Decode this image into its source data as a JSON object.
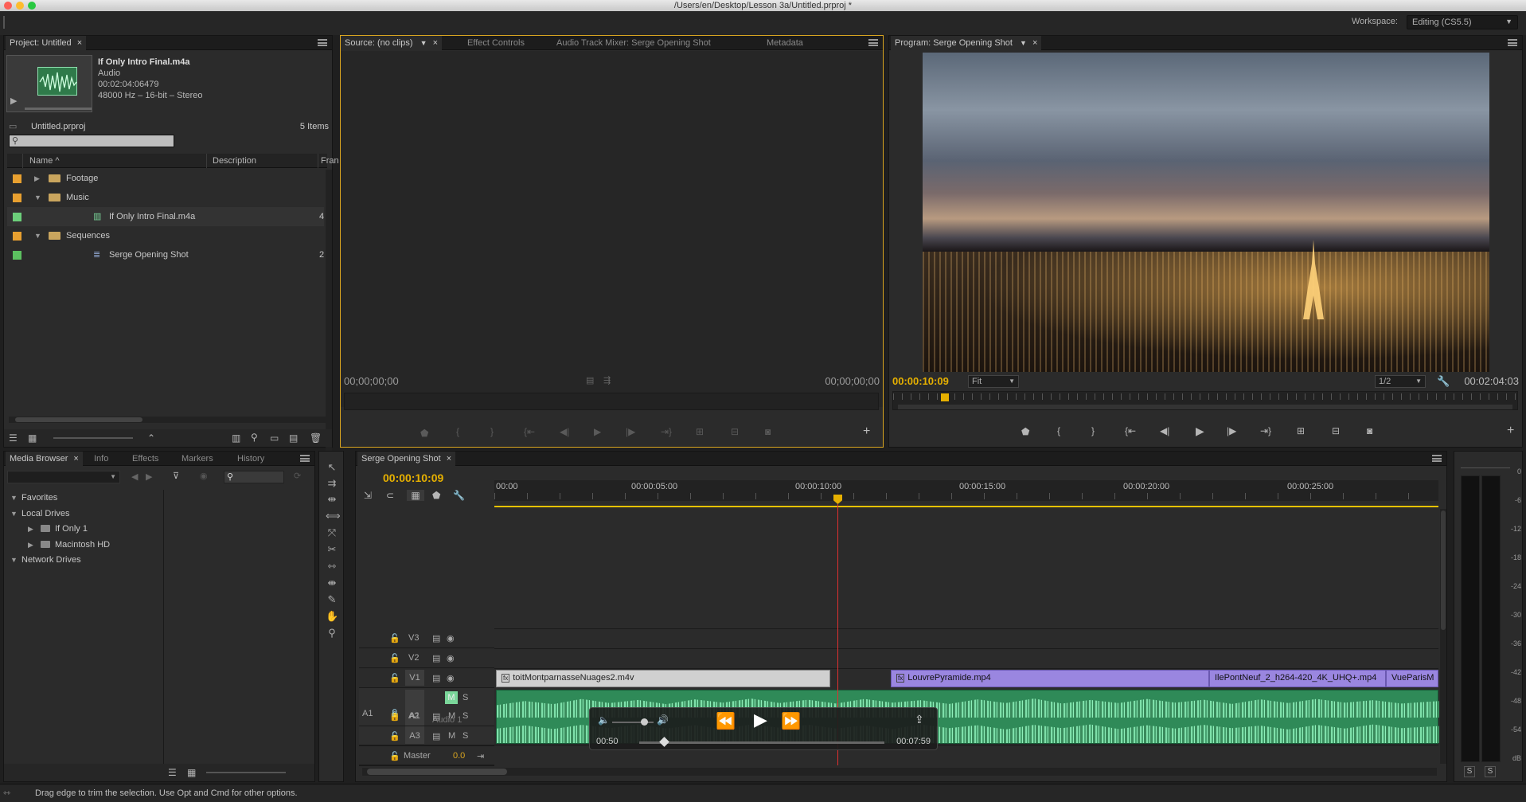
{
  "window": {
    "title": "/Users/en/Desktop/Lesson 3a/Untitled.prproj *"
  },
  "workspace": {
    "label": "Workspace:",
    "value": "Editing (CS5.5)"
  },
  "project": {
    "tab": "Project: Untitled",
    "clip_name": "If Only Intro Final.m4a",
    "clip_type": "Audio",
    "clip_duration": "00:02:04:06479",
    "clip_format": "48000 Hz – 16-bit – Stereo",
    "file_name": "Untitled.prproj",
    "item_count": "5 Items",
    "search_placeholder": "",
    "columns": {
      "name": "Name",
      "description": "Description",
      "frame": "Fran"
    },
    "items": [
      {
        "label": "Footage",
        "color": "#e8a030",
        "kind": "folder",
        "expanded": false,
        "indent": 0,
        "extra": ""
      },
      {
        "label": "Music",
        "color": "#e8a030",
        "kind": "folder",
        "expanded": true,
        "indent": 0,
        "extra": ""
      },
      {
        "label": "If Only Intro Final.m4a",
        "color": "#6ccf7a",
        "kind": "audio",
        "expanded": false,
        "indent": 1,
        "extra": "4"
      },
      {
        "label": "Sequences",
        "color": "#e8a030",
        "kind": "folder",
        "expanded": true,
        "indent": 0,
        "extra": ""
      },
      {
        "label": "Serge Opening Shot",
        "color": "#5cc060",
        "kind": "sequence",
        "expanded": false,
        "indent": 1,
        "extra": "2"
      }
    ]
  },
  "source": {
    "tabs": [
      "Source: (no clips)",
      "Effect Controls",
      "Audio Track Mixer: Serge Opening Shot",
      "Metadata"
    ],
    "tc_left": "00;00;00;00",
    "tc_right": "00;00;00;00"
  },
  "program": {
    "tab": "Program: Serge Opening Shot",
    "tc_current": "00:00:10:09",
    "fit": "Fit",
    "resolution": "1/2",
    "tc_duration": "00:02:04:03"
  },
  "media_browser": {
    "tabs": [
      "Media Browser",
      "Info",
      "Effects",
      "Markers",
      "History"
    ],
    "tree": [
      {
        "label": "Favorites",
        "indent": 0,
        "expanded": true,
        "drive": false
      },
      {
        "label": "Local Drives",
        "indent": 0,
        "expanded": true,
        "drive": false
      },
      {
        "label": "If Only 1",
        "indent": 1,
        "expanded": false,
        "drive": true
      },
      {
        "label": "Macintosh HD",
        "indent": 1,
        "expanded": false,
        "drive": true
      },
      {
        "label": "Network Drives",
        "indent": 0,
        "expanded": true,
        "drive": false
      }
    ]
  },
  "timeline": {
    "tab": "Serge Opening Shot",
    "tc": "00:00:10:09",
    "ruler": [
      "00:00",
      "00:00:05:00",
      "00:00:10:00",
      "00:00:15:00",
      "00:00:20:00",
      "00:00:25:00"
    ],
    "tracks": {
      "v3": "V3",
      "v2": "V2",
      "v1": "V1",
      "a1": "A1",
      "a1_name": "Audio 1",
      "a2": "A2",
      "a3": "A3",
      "master": "Master",
      "master_value": "0.0",
      "m": "M",
      "s": "S"
    },
    "clips": [
      {
        "name": "toitMontparnasseNuages2.m4v",
        "color": "#d0d0d0"
      },
      {
        "name": "LouvrePyramide.mp4",
        "color": "#9a86e0"
      },
      {
        "name": "IlePontNeuf_2_h264-420_4K_UHQ+.mp4",
        "color": "#9a86e0"
      },
      {
        "name": "VueParisM",
        "color": "#9a86e0"
      }
    ]
  },
  "player_overlay": {
    "elapsed": "00:50",
    "total": "00:07:59",
    "progress": 0.1
  },
  "meter": {
    "scale": [
      "0",
      "-6",
      "-12",
      "-18",
      "-24",
      "-30",
      "-36",
      "-42",
      "-48",
      "-54",
      "dB"
    ],
    "solo_left": "S",
    "solo_right": "S"
  },
  "status": {
    "text": "Drag edge to trim the selection. Use Opt and Cmd for other options."
  }
}
